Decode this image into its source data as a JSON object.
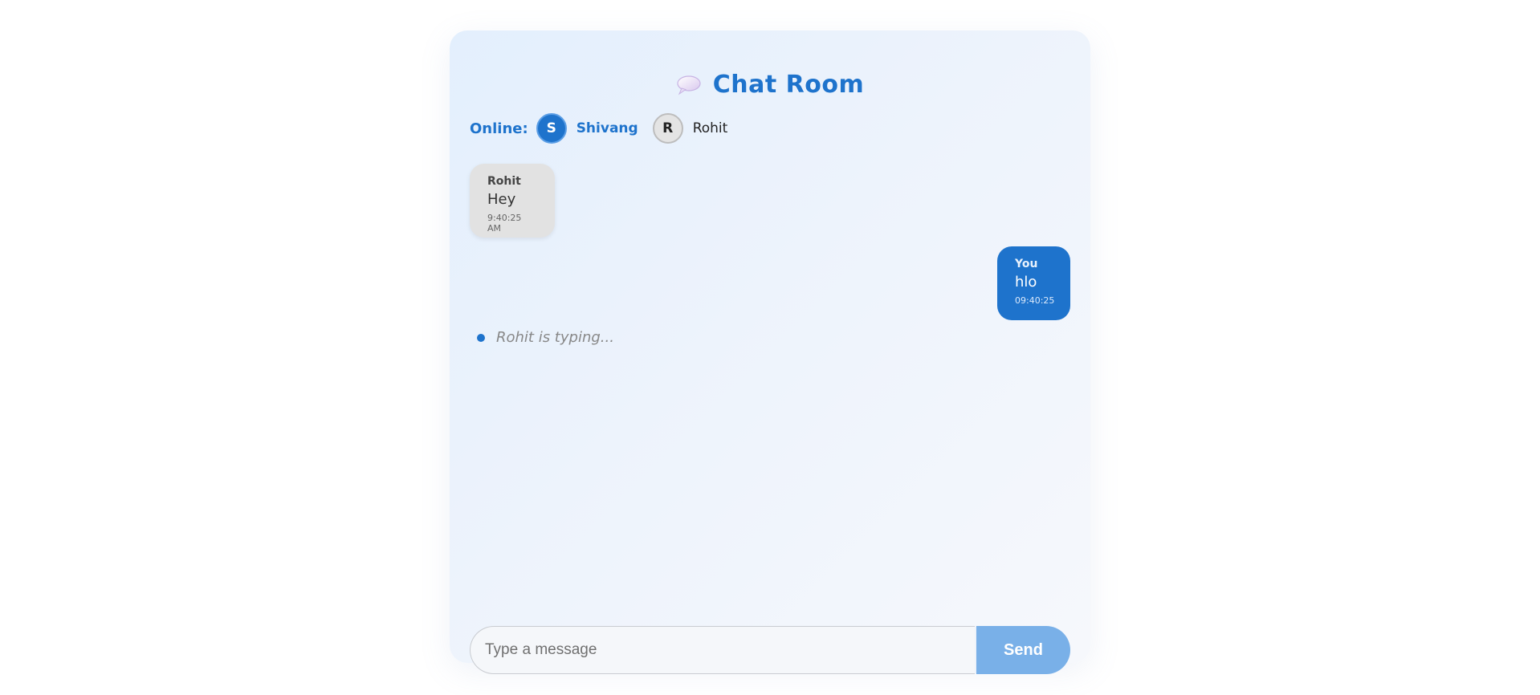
{
  "header": {
    "title": "Chat Room",
    "icon": "speech-balloon-icon"
  },
  "online": {
    "label": "Online:",
    "users": [
      {
        "initial": "S",
        "name": "Shivang",
        "is_self": true
      },
      {
        "initial": "R",
        "name": "Rohit",
        "is_self": false
      }
    ]
  },
  "messages": [
    {
      "sender": "Rohit",
      "text": "Hey",
      "time": "9:40:25 AM",
      "direction": "incoming"
    },
    {
      "sender": "You",
      "text": "hlo",
      "time": "09:40:25",
      "direction": "outgoing"
    }
  ],
  "typing": {
    "text": "Rohit is typing..."
  },
  "composer": {
    "placeholder": "Type a message",
    "value": "",
    "send_label": "Send"
  },
  "colors": {
    "accent": "#1e73cc",
    "send_button": "#79b0e8",
    "incoming_bubble": "#e2e2e2"
  }
}
